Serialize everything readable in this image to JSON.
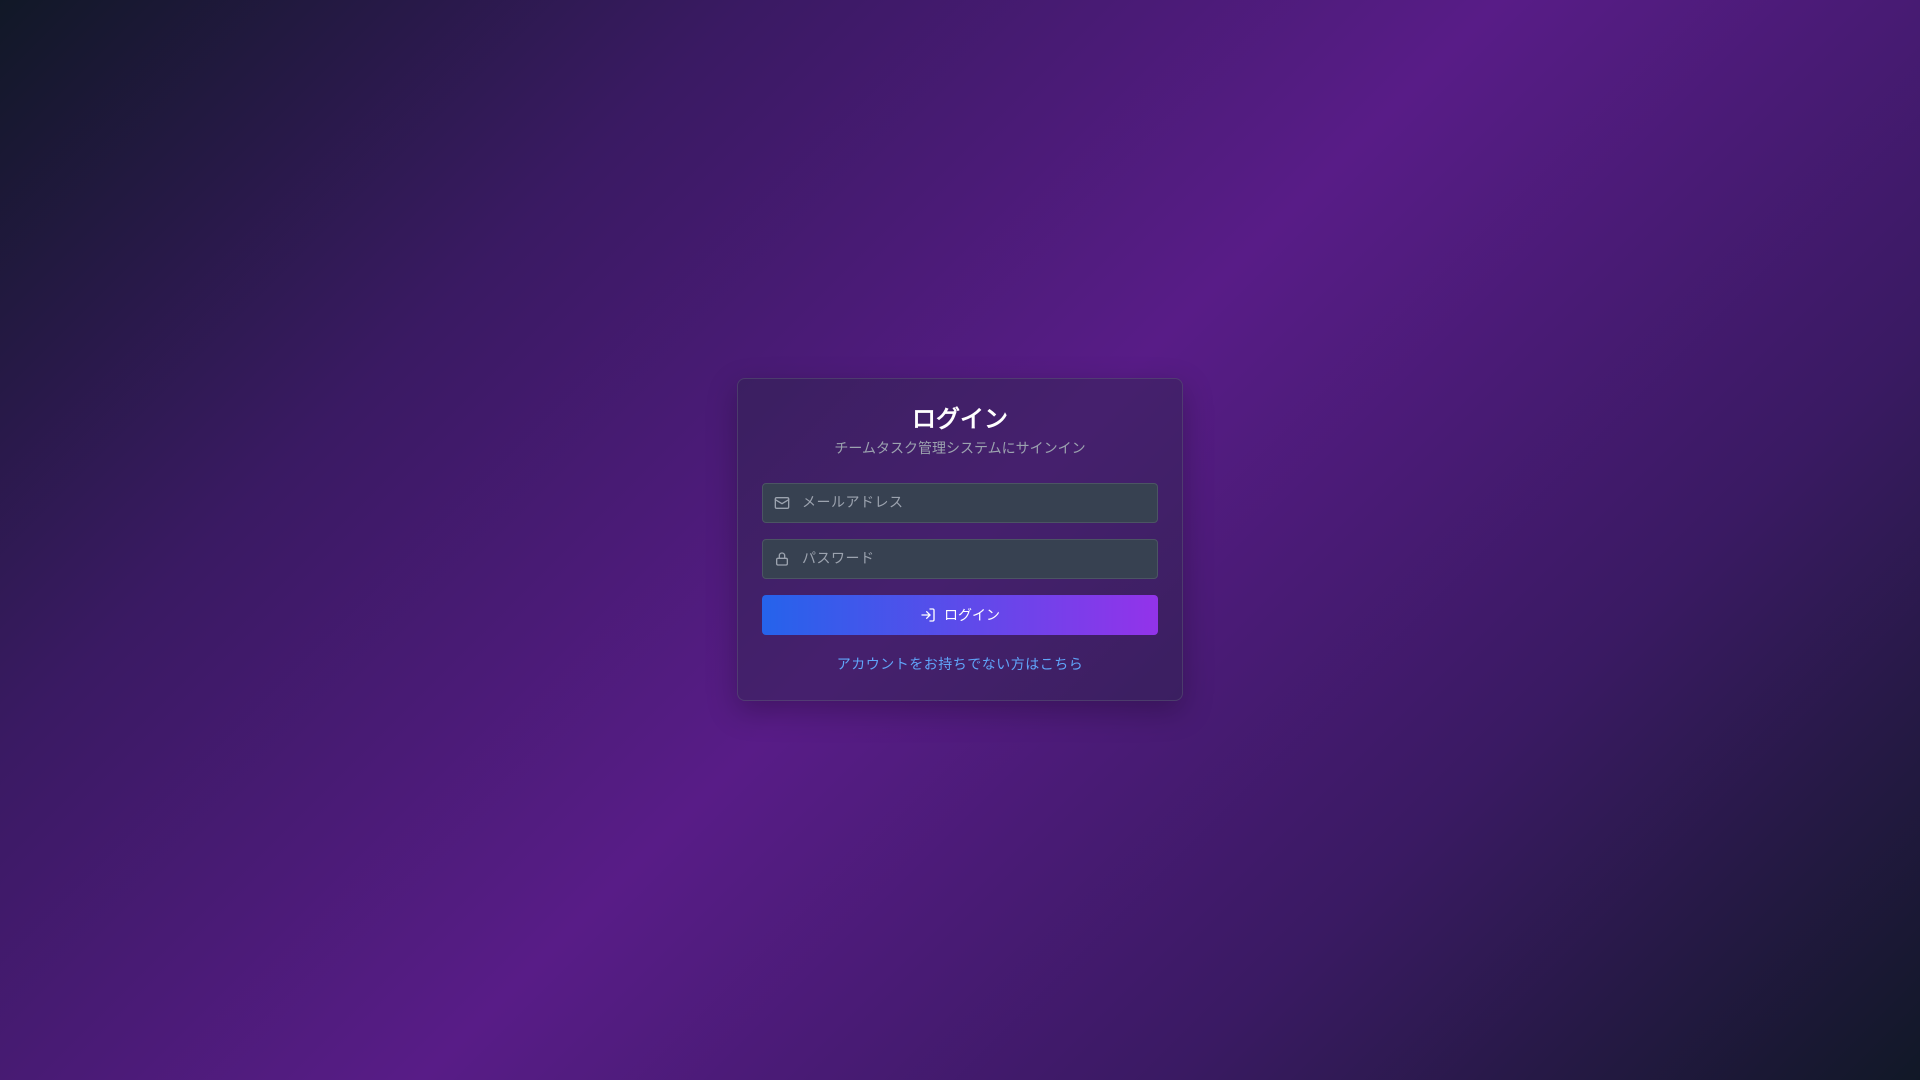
{
  "login_card": {
    "title": "ログイン",
    "subtitle": "チームタスク管理システムにサインイン",
    "email_field": {
      "placeholder": "メールアドレス",
      "value": "",
      "icon": "mail-icon"
    },
    "password_field": {
      "placeholder": "パスワード",
      "value": "",
      "icon": "lock-icon"
    },
    "login_button": {
      "label": "ログイン",
      "icon": "log-in-icon"
    },
    "register_link": "アカウントをお持ちでない方はこちら"
  },
  "colors": {
    "background_start": "#111827",
    "background_mid": "#581c87",
    "button_gradient_start": "#2563eb",
    "button_gradient_end": "#9333ea",
    "link": "#60a5fa"
  }
}
